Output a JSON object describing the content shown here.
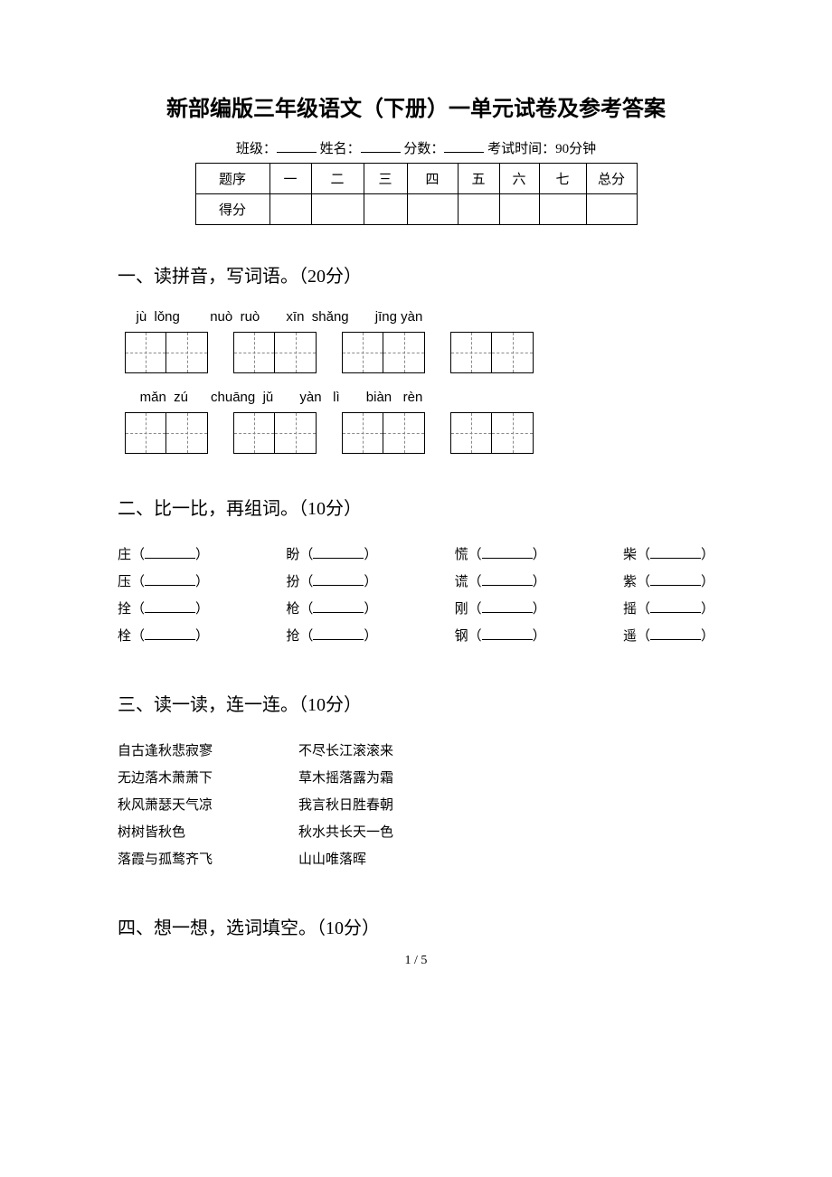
{
  "title": "新部编版三年级语文（下册）一单元试卷及参考答案",
  "meta": {
    "class_label": "班级：",
    "name_label": "姓名：",
    "score_label": "分数：",
    "time_label": "考试时间：90分钟"
  },
  "score_table": {
    "row_label1": "题序",
    "row_label2": "得分",
    "cols": [
      "一",
      "二",
      "三",
      "四",
      "五",
      "六",
      "七",
      "总分"
    ]
  },
  "sections": {
    "s1": {
      "heading": "一、读拼音，写词语。（20分）",
      "pinyin_row1": "   jù  lǒng        nuò  ruò       xīn  shǎng       jīng yàn",
      "pinyin_row2": "    mǎn  zú      chuāng  jǔ       yàn   lì       biàn   rèn"
    },
    "s2": {
      "heading": "二、比一比，再组词。（10分）",
      "rows": [
        [
          [
            "庄",
            ""
          ],
          [
            "盼",
            ""
          ],
          [
            "慌",
            ""
          ],
          [
            "柴",
            ""
          ]
        ],
        [
          [
            "压",
            ""
          ],
          [
            "扮",
            ""
          ],
          [
            "谎",
            ""
          ],
          [
            "紫",
            ""
          ]
        ],
        [
          [
            "拴",
            ""
          ],
          [
            "枪",
            ""
          ],
          [
            "刚",
            ""
          ],
          [
            "摇",
            ""
          ]
        ],
        [
          [
            "栓",
            ""
          ],
          [
            "抢",
            ""
          ],
          [
            "钢",
            ""
          ],
          [
            "遥",
            ""
          ]
        ]
      ]
    },
    "s3": {
      "heading": "三、读一读，连一连。（10分）",
      "pairs": [
        [
          "自古逢秋悲寂寥",
          "不尽长江滚滚来"
        ],
        [
          "无边落木萧萧下",
          "草木摇落露为霜"
        ],
        [
          "秋风萧瑟天气凉",
          "我言秋日胜春朝"
        ],
        [
          "树树皆秋色",
          "秋水共长天一色"
        ],
        [
          "落霞与孤鹜齐飞",
          "山山唯落晖"
        ]
      ]
    },
    "s4": {
      "heading": "四、想一想，选词填空。（10分）"
    }
  },
  "page_num": "1 / 5"
}
